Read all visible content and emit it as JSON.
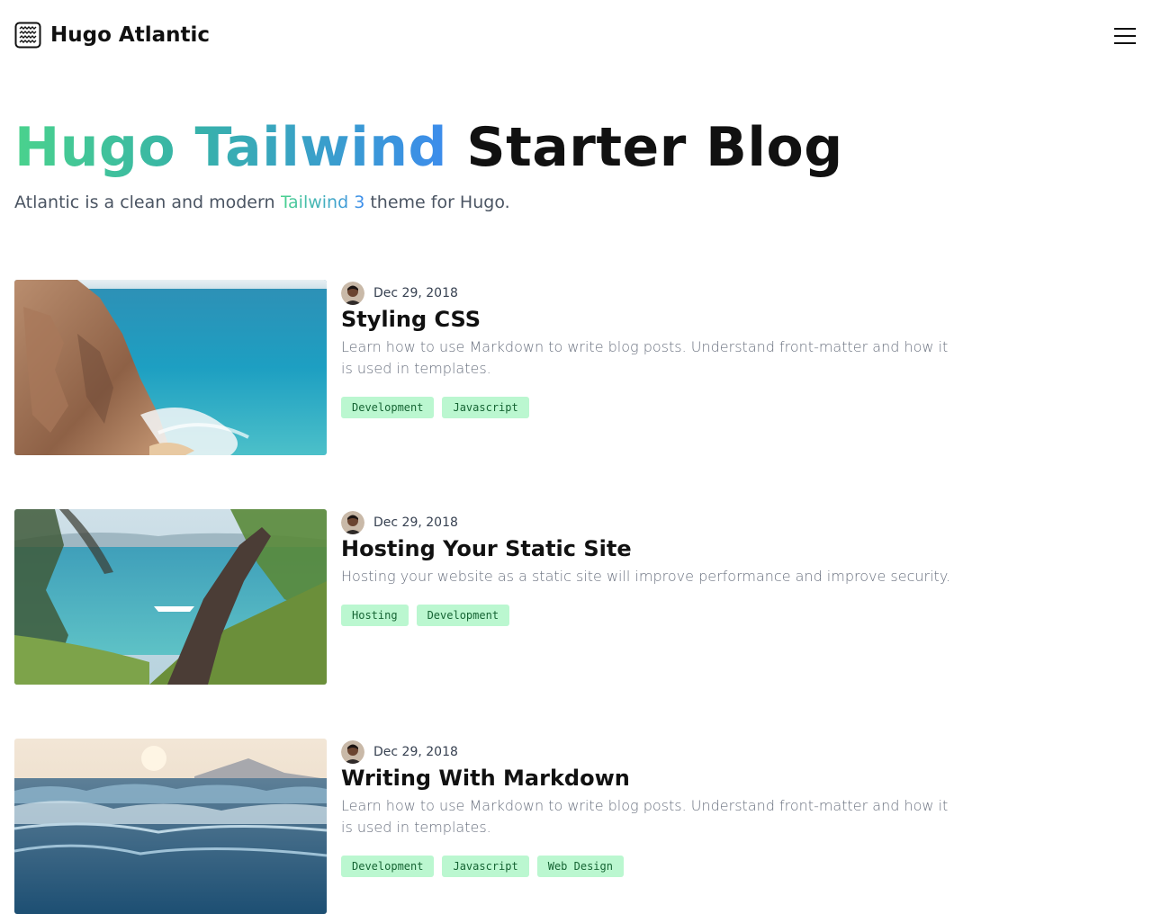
{
  "header": {
    "brand": "Hugo Atlantic",
    "logo_icon": "waves-logo-icon",
    "menu_icon": "hamburger-menu-icon"
  },
  "hero": {
    "title_highlight": "Hugo Tailwind",
    "title_rest": "Starter Blog",
    "subtitle_before": "Atlantic is a clean and modern",
    "subtitle_highlight": "Tailwind 3",
    "subtitle_after": "theme for Hugo.",
    "gradient_colors": [
      "#4ad28d",
      "#3c8cec"
    ]
  },
  "posts": [
    {
      "date": "Dec 29, 2018",
      "title": "Styling CSS",
      "excerpt": "Learn how to use Markdown to write blog posts. Understand front-matter and how it is used in templates.",
      "tags": [
        "Development",
        "Javascript"
      ],
      "image": "coastal-cliff-ocean-photo"
    },
    {
      "date": "Dec 29, 2018",
      "title": "Hosting Your Static Site",
      "excerpt": "Hosting your website as a static site will improve performance and improve security.",
      "tags": [
        "Hosting",
        "Development"
      ],
      "image": "sea-through-pine-branches-photo"
    },
    {
      "date": "Dec 29, 2018",
      "title": "Writing With Markdown",
      "excerpt": "Learn how to use Markdown to write blog posts. Understand front-matter and how it is used in templates.",
      "tags": [
        "Development",
        "Javascript",
        "Web Design"
      ],
      "image": "ocean-waves-sunset-photo"
    }
  ],
  "colors": {
    "tag_bg": "#bbf7d0",
    "tag_text": "#166534",
    "excerpt_text": "#6b7280"
  }
}
